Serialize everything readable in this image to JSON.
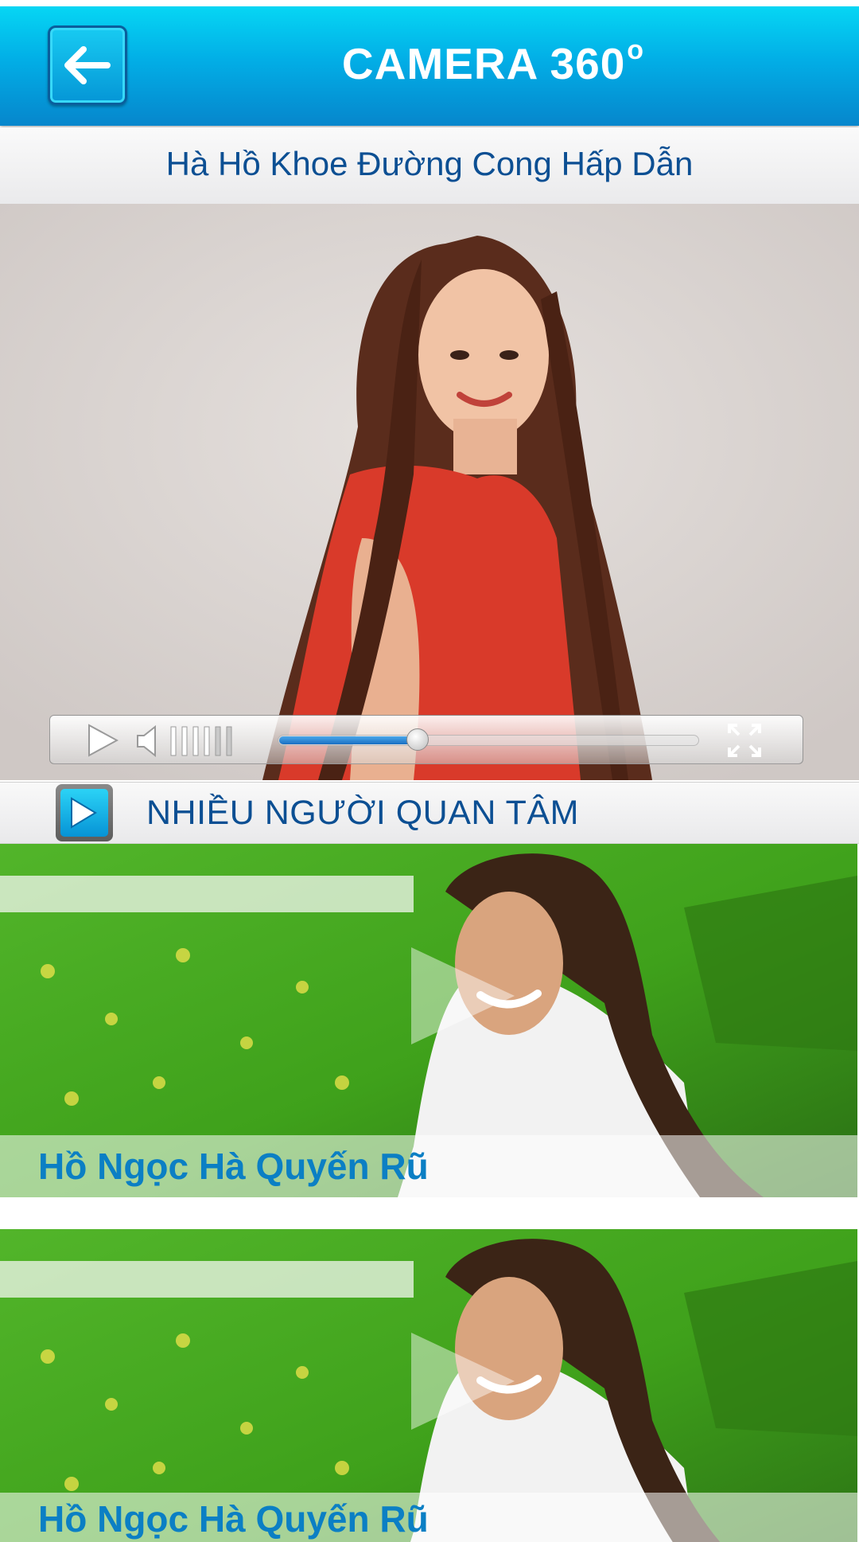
{
  "header": {
    "title": "CAMERA 360",
    "title_degree": "o",
    "back_icon": "arrow-left-icon"
  },
  "video": {
    "title": "Hà Hồ Khoe Đường Cong Hấp Dẫn",
    "progress": 0.33,
    "volume_level": 0.55,
    "play_icon": "play-icon",
    "volume_icon": "speaker-icon",
    "fullscreen_icon": "fullscreen-icon"
  },
  "section": {
    "title": "NHIỀU NGƯỜI QUAN TÂM",
    "icon": "play-icon"
  },
  "related": [
    {
      "caption": "Hồ Ngọc Hà Quyến Rũ"
    },
    {
      "caption": "Hồ Ngọc Hà Quyến Rũ"
    }
  ],
  "colors": {
    "header_top": "#06d6f4",
    "header_bottom": "#0686cc",
    "title_text": "#0c4f93",
    "caption_text": "#0b7fc4",
    "progress": "#1f86d8"
  }
}
